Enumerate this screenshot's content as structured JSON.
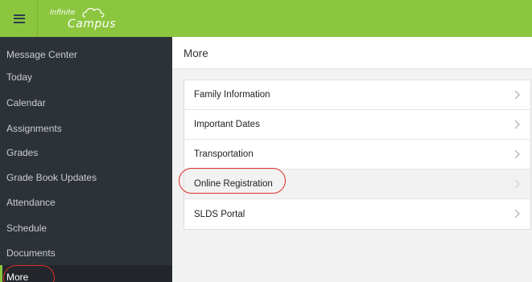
{
  "app": {
    "logo_line1": "Infinite",
    "logo_line2": "Campus"
  },
  "sidebar": {
    "items": [
      {
        "label": "Message Center"
      },
      {
        "label": "Today"
      },
      {
        "label": "Calendar"
      },
      {
        "label": "Assignments"
      },
      {
        "label": "Grades"
      },
      {
        "label": "Grade Book Updates"
      },
      {
        "label": "Attendance"
      },
      {
        "label": "Schedule"
      },
      {
        "label": "Documents"
      },
      {
        "label": "More",
        "active": true
      }
    ]
  },
  "main": {
    "title": "More",
    "items": [
      {
        "label": "Family Information"
      },
      {
        "label": "Important Dates"
      },
      {
        "label": "Transportation"
      },
      {
        "label": "Online Registration",
        "highlighted": true
      },
      {
        "label": "SLDS Portal"
      }
    ]
  },
  "colors": {
    "brand_green": "#8cc63f",
    "sidebar_bg": "#2d3237",
    "annotation_red": "#d9312b"
  }
}
